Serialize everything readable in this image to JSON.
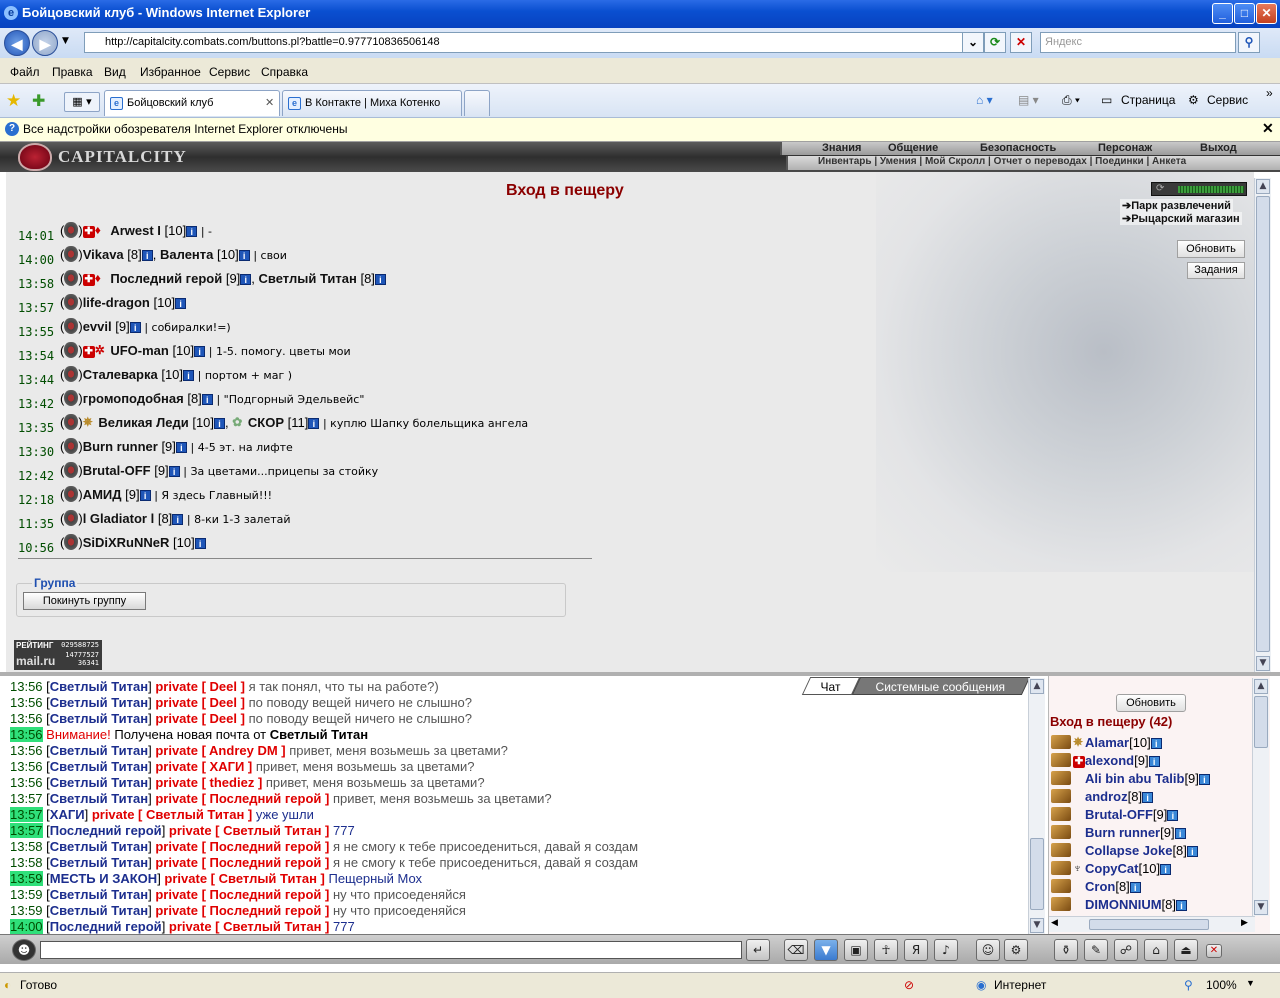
{
  "window": {
    "title": "Бойцовский клуб - Windows Internet Explorer",
    "min": "_",
    "max": "□",
    "close": "✕"
  },
  "address": {
    "url": "http://capitalcity.combats.com/buttons.pl?battle=0.977710836506148",
    "search_placeholder": "Яндекс"
  },
  "menu": [
    "Файл",
    "Правка",
    "Вид",
    "Избранное",
    "Сервис",
    "Справка"
  ],
  "tabs": [
    {
      "label": "Бойцовский клуб",
      "active": true
    },
    {
      "label": "В Контакте | Миха Котенко",
      "active": false
    }
  ],
  "commands": {
    "page": "Страница",
    "tools": "Сервис"
  },
  "infobar": "Все надстройки обозревателя Internet Explorer отключены",
  "game": {
    "logo": "CAPITALCITY",
    "topnav": [
      "Знания",
      "Общение",
      "Безопасность",
      "Персонаж",
      "Выход"
    ],
    "subnav": "Инвентарь | Умения | Мой Скролл | Отчет о переводах | Поединки | Анкета",
    "page_title": "Вход в пещеру",
    "right_links": [
      "Парк развлечений",
      "Рыцарский магазин"
    ],
    "right_buttons": {
      "refresh": "Обновить",
      "tasks": "Задания"
    },
    "groups": [
      {
        "time": "14:01",
        "players": [
          {
            "name": "Arwest I",
            "level": "[10]"
          }
        ],
        "comment": "| -"
      },
      {
        "time": "14:00",
        "players": [
          {
            "name": "Vikava",
            "level": "[8]"
          },
          {
            "name": "Валента",
            "level": "[10]"
          }
        ],
        "comment": "| свои"
      },
      {
        "time": "13:58",
        "players": [
          {
            "name": "Последний герой",
            "level": "[9]"
          },
          {
            "name": "Светлый Титан",
            "level": "[8]"
          }
        ],
        "comment": ""
      },
      {
        "time": "13:57",
        "players": [
          {
            "name": "life-dragon",
            "level": "[10]"
          }
        ],
        "comment": ""
      },
      {
        "time": "13:55",
        "players": [
          {
            "name": "evvil",
            "level": "[9]"
          }
        ],
        "comment": "| собиралки!=)"
      },
      {
        "time": "13:54",
        "players": [
          {
            "name": "UFO-man",
            "level": "[10]"
          }
        ],
        "comment": "| 1-5. помогу. цветы мои"
      },
      {
        "time": "13:44",
        "players": [
          {
            "name": "Сталеварка",
            "level": "[10]"
          }
        ],
        "comment": "| портом + маг )"
      },
      {
        "time": "13:42",
        "players": [
          {
            "name": "громоподобная",
            "level": "[8]"
          }
        ],
        "comment": "| \"Подгорный Эдельвейс\""
      },
      {
        "time": "13:35",
        "players": [
          {
            "name": "Великая Леди",
            "level": "[10]"
          },
          {
            "name": "СКОР",
            "level": "[11]"
          }
        ],
        "comment": "| куплю Шапку болельщика ангела"
      },
      {
        "time": "13:30",
        "players": [
          {
            "name": "Burn runner",
            "level": "[9]"
          }
        ],
        "comment": "| 4-5 эт. на лифте"
      },
      {
        "time": "12:42",
        "players": [
          {
            "name": "Brutal-OFF",
            "level": "[9]"
          }
        ],
        "comment": "| За цветами...прицепы за стойку"
      },
      {
        "time": "12:18",
        "players": [
          {
            "name": "АМИД",
            "level": "[9]"
          }
        ],
        "comment": "| Я здесь Главный!!!"
      },
      {
        "time": "11:35",
        "players": [
          {
            "name": "l Gladiator l",
            "level": "[8]"
          }
        ],
        "comment": "| 8-ки 1-3 залетай"
      },
      {
        "time": "10:56",
        "players": [
          {
            "name": "SiDiXRuNNeR",
            "level": "[10]"
          }
        ],
        "comment": ""
      }
    ],
    "group_label": "Группа",
    "leave_group": "Покинуть группу",
    "mailru": {
      "top": "РЕЙТИНГ",
      "brand": "mail.ru",
      "n1": "029588725",
      "n2": "14777527",
      "n3": "36341"
    }
  },
  "chat": {
    "tabs": [
      "Чат",
      "Системные сообщения"
    ],
    "lines": [
      {
        "t": "13:56",
        "hl": false,
        "from": "Светлый Титан",
        "to": "Deel",
        "text": "я так понял, что ты на работе?)"
      },
      {
        "t": "13:56",
        "hl": false,
        "from": "Светлый Титан",
        "to": "Deel",
        "text": "по поводу вещей ничего не слышно?"
      },
      {
        "t": "13:56",
        "hl": false,
        "from": "Светлый Титан",
        "to": "Deel",
        "text": "по поводу вещей ничего не слышно?"
      },
      {
        "t": "13:56",
        "hl": true,
        "system": true,
        "warn": "Внимание!",
        "sys_text": "Получена новая почта от",
        "sys_name": "Светлый Титан"
      },
      {
        "t": "13:56",
        "hl": false,
        "from": "Светлый Титан",
        "to": "Andrey DM",
        "text": "привет, меня возьмешь за цветами?"
      },
      {
        "t": "13:56",
        "hl": false,
        "from": "Светлый Титан",
        "to": "ХАГИ",
        "text": "привет, меня возьмешь за цветами?"
      },
      {
        "t": "13:56",
        "hl": false,
        "from": "Светлый Титан",
        "to": "thediez",
        "text": "привет, меня возьмешь за цветами?"
      },
      {
        "t": "13:57",
        "hl": false,
        "from": "Светлый Титан",
        "to": "Последний герой",
        "text": "привет, меня возьмешь за цветами?"
      },
      {
        "t": "13:57",
        "hl": true,
        "from": "ХАГИ",
        "to": "Светлый Титан",
        "text": "уже ушли",
        "blue": true
      },
      {
        "t": "13:57",
        "hl": true,
        "from": "Последний герой",
        "to": "Светлый Титан",
        "text": "777",
        "blue": true
      },
      {
        "t": "13:58",
        "hl": false,
        "from": "Светлый Титан",
        "to": "Последний герой",
        "text": "я не смогу к тебе присоедениться, давай я создам"
      },
      {
        "t": "13:58",
        "hl": false,
        "from": "Светлый Титан",
        "to": "Последний герой",
        "text": "я не смогу к тебе присоедениться, давай я создам"
      },
      {
        "t": "13:59",
        "hl": true,
        "from": "МЕСТЬ И ЗАКОН",
        "to": "Светлый Титан",
        "text": "Пещерный Мох",
        "blue": true
      },
      {
        "t": "13:59",
        "hl": false,
        "from": "Светлый Титан",
        "to": "Последний герой",
        "text": "ну что присоеденяйся"
      },
      {
        "t": "13:59",
        "hl": false,
        "from": "Светлый Титан",
        "to": "Последний герой",
        "text": "ну что присоеденяйся"
      },
      {
        "t": "14:00",
        "hl": true,
        "from": "Последний герой",
        "to": "Светлый Титан",
        "text": "777",
        "blue": true
      }
    ]
  },
  "userlist": {
    "refresh": "Обновить",
    "title": "Вход в пещеру (42)",
    "users": [
      {
        "name": "Alamar",
        "level": "[10]"
      },
      {
        "name": "alexond",
        "level": "[9]"
      },
      {
        "name": "Ali bin abu Talib",
        "level": "[9]"
      },
      {
        "name": "androz",
        "level": "[8]"
      },
      {
        "name": "Brutal-OFF",
        "level": "[9]"
      },
      {
        "name": "Burn runner",
        "level": "[9]"
      },
      {
        "name": "Collapse Joke",
        "level": "[8]"
      },
      {
        "name": "CopyCat",
        "level": "[10]"
      },
      {
        "name": "Cron",
        "level": "[8]"
      },
      {
        "name": "DIMONNIUM",
        "level": "[8]"
      }
    ]
  },
  "status": {
    "ready": "Готово",
    "zone": "Интернет",
    "zoom": "100%"
  },
  "colors": {
    "title_red": "#8b0000",
    "chat_name": "#1c2e8e",
    "private_red": "#e00000",
    "time_highlight": "#2fe07a"
  }
}
